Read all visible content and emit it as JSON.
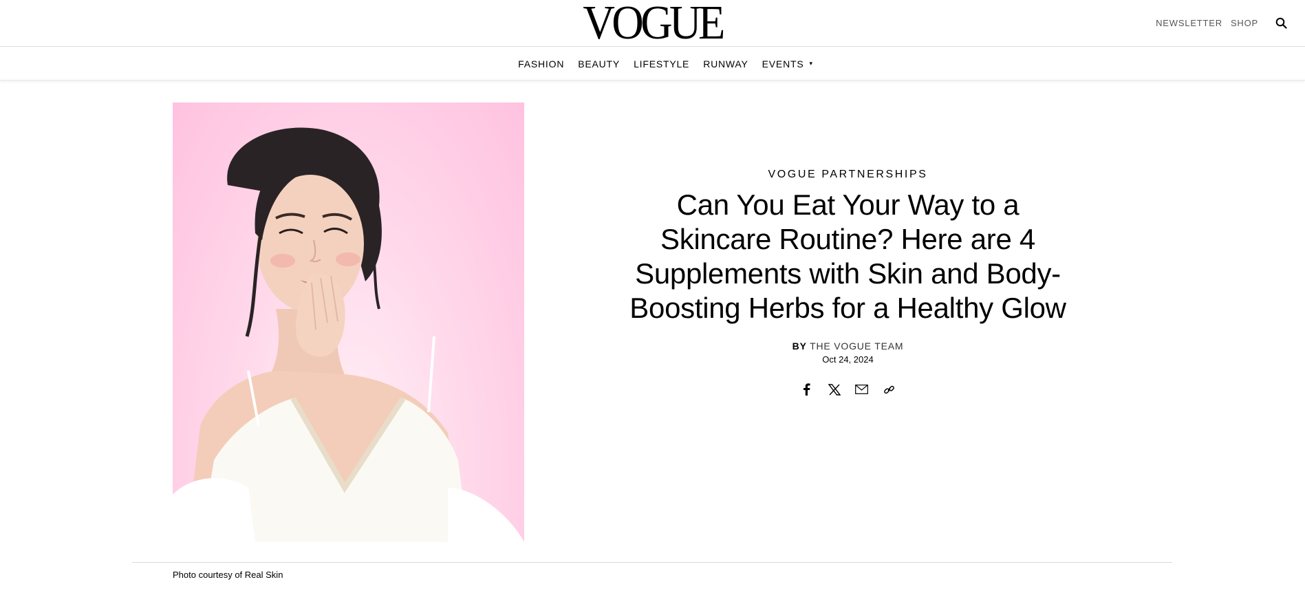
{
  "header": {
    "logo": "VOGUE",
    "utility_links": [
      "NEWSLETTER",
      "SHOP"
    ],
    "search_icon": "search-icon"
  },
  "nav": {
    "items": [
      "FASHION",
      "BEAUTY",
      "LIFESTYLE",
      "RUNWAY",
      "EVENTS"
    ],
    "events_caret": "▾"
  },
  "article": {
    "kicker": "VOGUE PARTNERSHIPS",
    "headline": "Can You Eat Your Way to a Skincare Routine? Here are 4 Supplements with Skin and Body-Boosting Herbs for a Healthy Glow",
    "byline_prefix": "BY",
    "author": "THE VOGUE TEAM",
    "date": "Oct 24, 2024",
    "share_icons": [
      "facebook-icon",
      "x-icon",
      "email-icon",
      "link-icon"
    ],
    "photo_caption": "Photo courtesy of Real Skin"
  },
  "colors": {
    "photo_background": "#ffc8e4",
    "divider": "#d9d9d9"
  }
}
